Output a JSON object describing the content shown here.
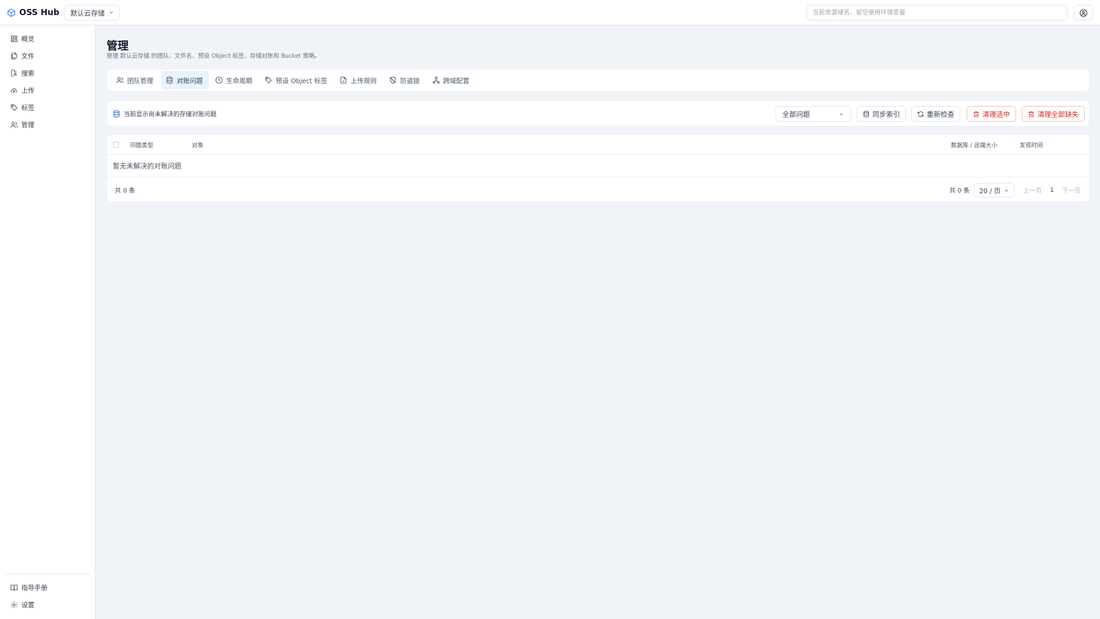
{
  "app": {
    "brand": "OSS Hub",
    "storage_selector": "默认云存储",
    "search_placeholder": "当前资源域名，留空使用环境变量"
  },
  "sidebar": {
    "items": [
      {
        "label": "概览",
        "icon": "dashboard-icon"
      },
      {
        "label": "文件",
        "icon": "files-icon"
      },
      {
        "label": "搜索",
        "icon": "search-file-icon"
      },
      {
        "label": "上传",
        "icon": "upload-cloud-icon"
      },
      {
        "label": "标签",
        "icon": "tags-icon"
      },
      {
        "label": "管理",
        "icon": "users-icon"
      }
    ],
    "bottom_items": [
      {
        "label": "指导手册",
        "icon": "book-icon"
      },
      {
        "label": "设置",
        "icon": "gear-icon"
      }
    ]
  },
  "page": {
    "title": "管理",
    "description": "管理 默认云存储 的团队、文件名、预设 Object 标签、存储对账和 Bucket 策略。"
  },
  "tabs": [
    {
      "label": "团队管理",
      "icon": "users-icon"
    },
    {
      "label": "对账问题",
      "icon": "database-icon",
      "active": true
    },
    {
      "label": "生命周期",
      "icon": "clock-icon"
    },
    {
      "label": "预设 Object 标签",
      "icon": "tags-icon"
    },
    {
      "label": "上传规则",
      "icon": "file-rule-icon"
    },
    {
      "label": "防盗链",
      "icon": "shield-off-icon"
    },
    {
      "label": "跨域配置",
      "icon": "network-icon"
    }
  ],
  "toolbar": {
    "note": "当前显示尚未解决的存储对账问题",
    "filter_value": "全部问题",
    "sync_label": "同步索引",
    "recheck_label": "重新检查",
    "clear_selected_label": "清理选中",
    "clear_all_missing_label": "清理全部缺失"
  },
  "table": {
    "columns": {
      "type": "问题类型",
      "object": "对象",
      "size": "数据库 / 远端大小",
      "time": "发现时间"
    },
    "empty_text": "暂无未解决的对账问题",
    "footer_total": "共 0 条",
    "pager_total": "共 0 条",
    "page_size": "20 / 页",
    "prev": "上一页",
    "page_number": "1",
    "next": "下一页"
  },
  "colors": {
    "accent": "#2563eb",
    "danger": "#dc2626",
    "background": "#f0f4f8",
    "active_tab": "#eaf2fb"
  }
}
